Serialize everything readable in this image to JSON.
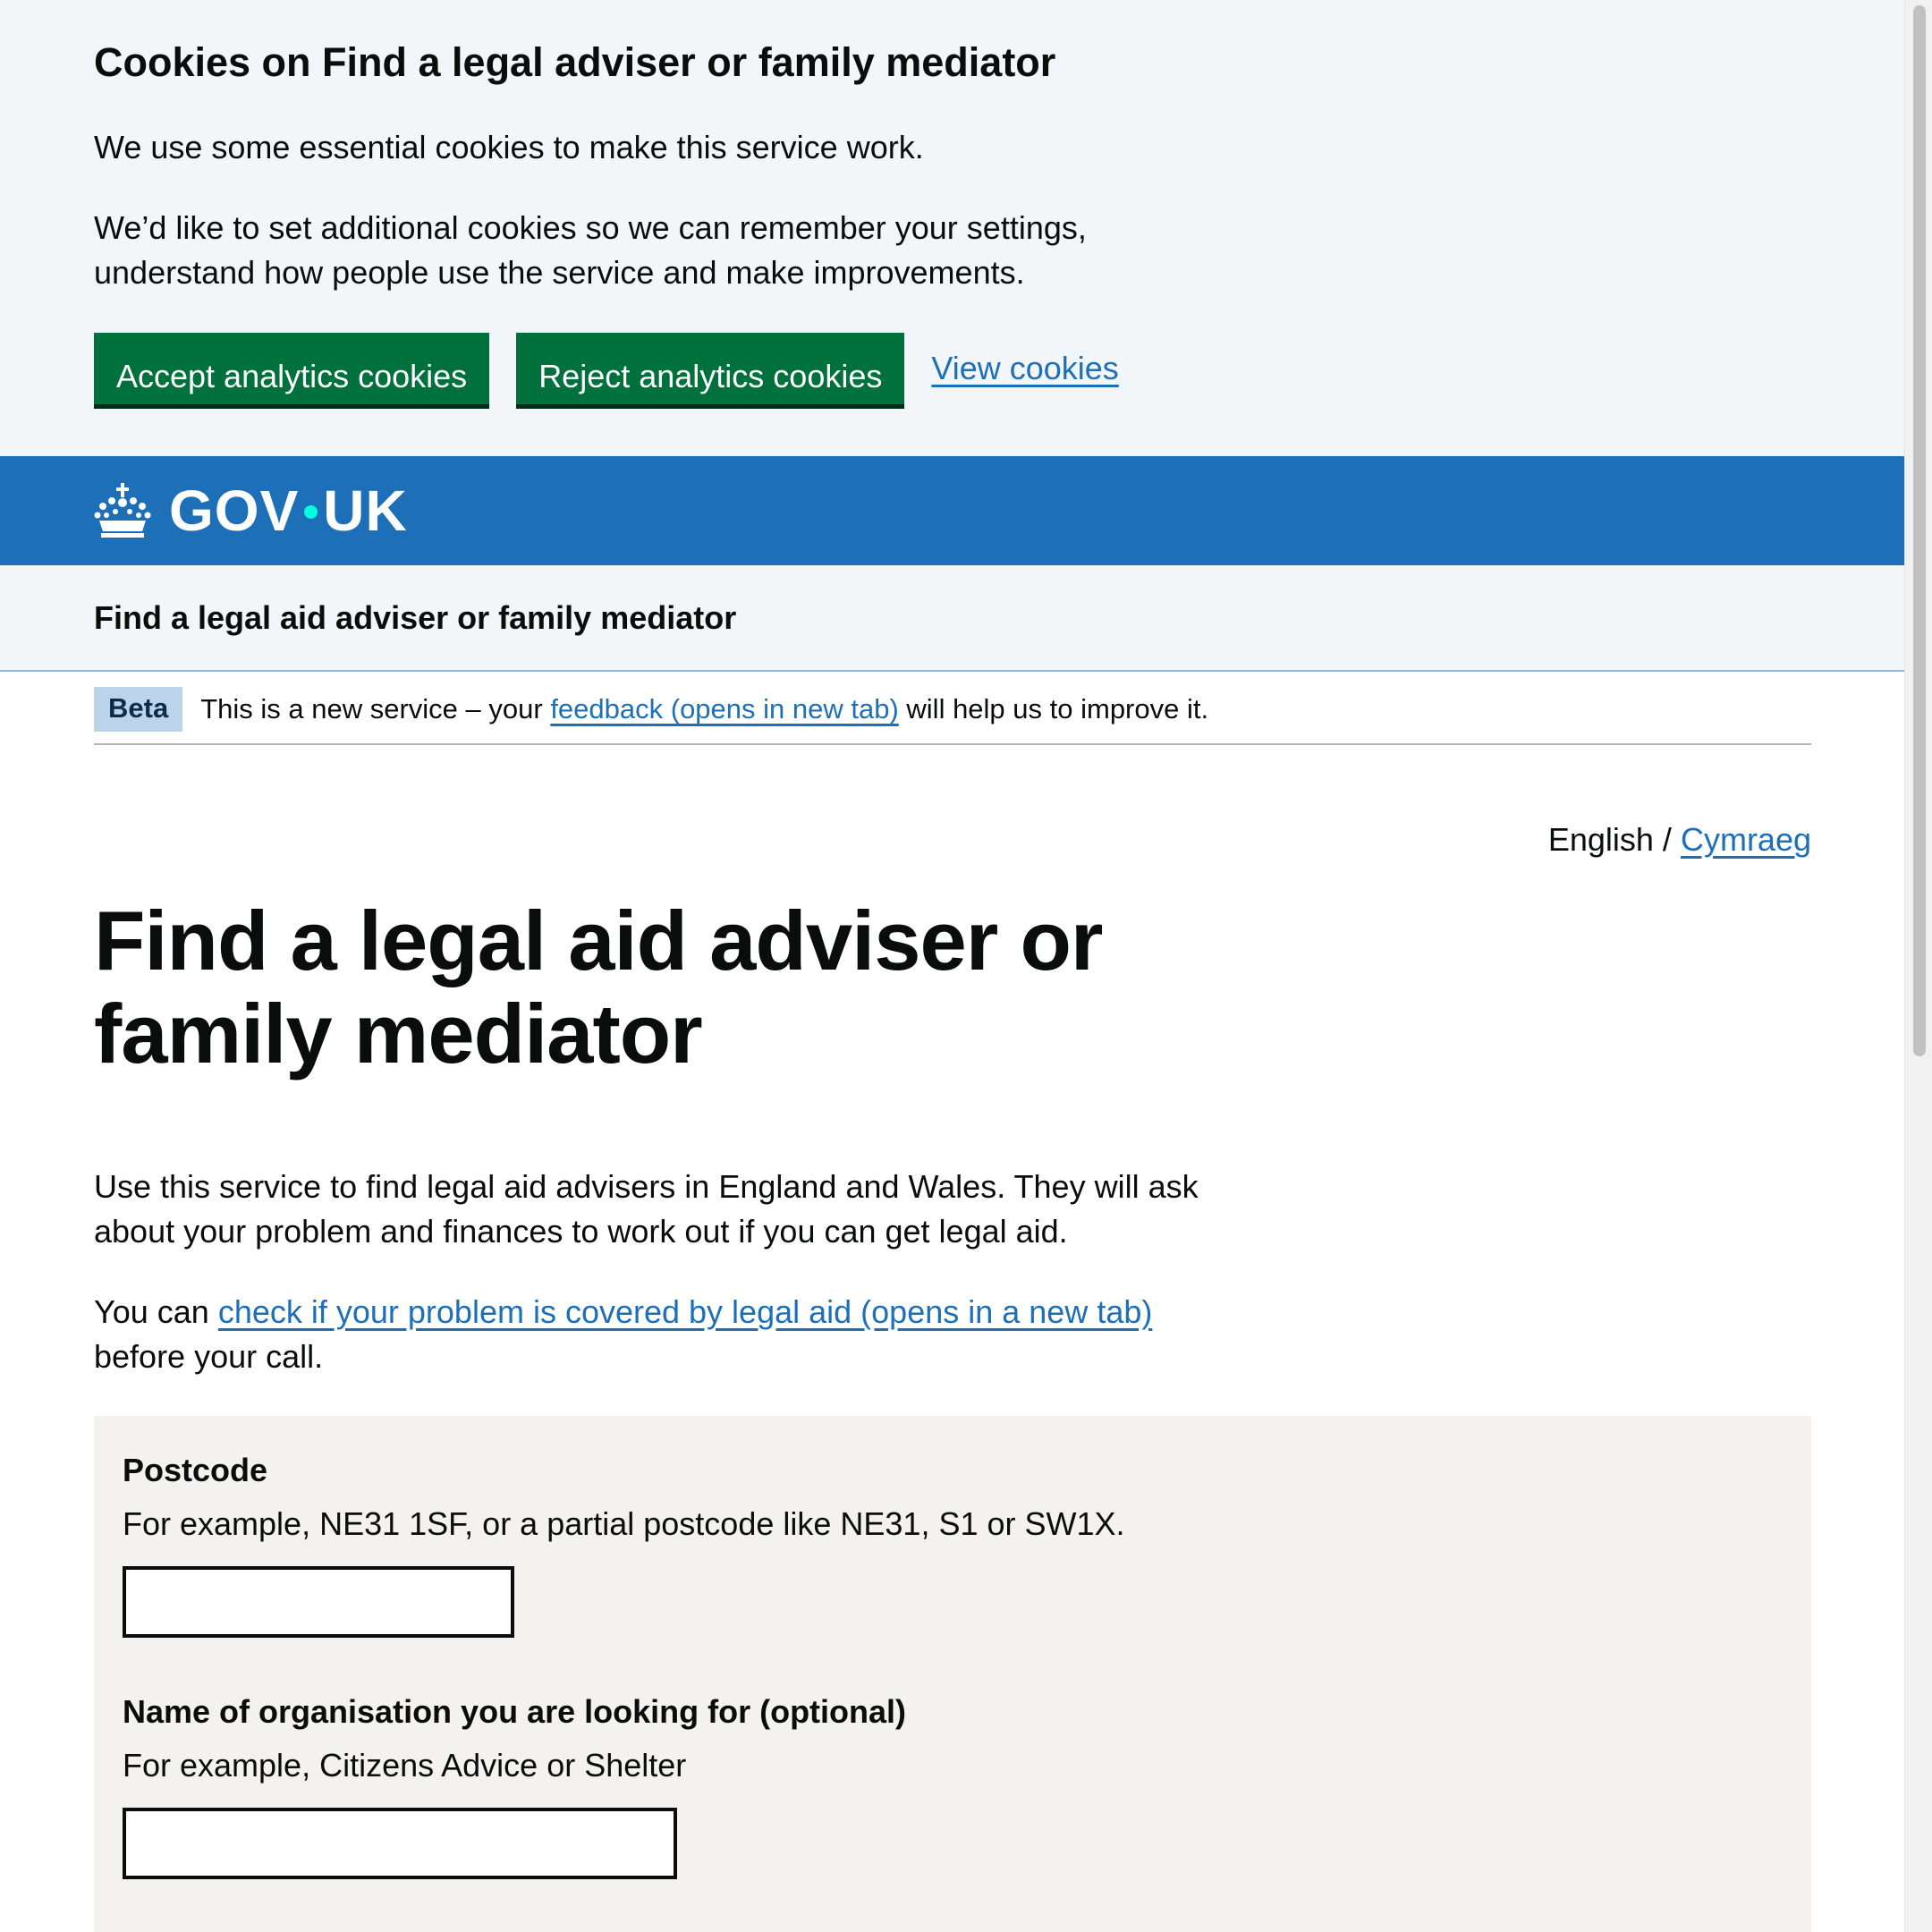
{
  "cookie_banner": {
    "title": "Cookies on Find a legal adviser or family mediator",
    "text_1": "We use some essential cookies to make this service work.",
    "text_2": "We’d like to set additional cookies so we can remember your settings, understand how people use the service and make improvements.",
    "accept_label": "Accept analytics cookies",
    "reject_label": "Reject analytics cookies",
    "view_label": "View cookies"
  },
  "header": {
    "logo_text_1": "GOV",
    "logo_text_2": "UK",
    "icon": "crown-icon"
  },
  "service": {
    "name": "Find a legal aid adviser or family mediator"
  },
  "phase_banner": {
    "tag": "Beta",
    "text_before": "This is a new service – your",
    "link_text": "feedback (opens in new tab)",
    "text_after": "will help us to improve it."
  },
  "language": {
    "current": "English",
    "separator": "/",
    "other": "Cymraeg"
  },
  "main": {
    "title": "Find a legal aid adviser or family mediator",
    "intro": "Use this service to find legal aid advisers in England and Wales. They will ask about your problem and finances to work out if you can get legal aid.",
    "intro2_before": "You can",
    "intro2_link": "check if your problem is covered by legal aid (opens in a new tab)",
    "intro2_after": "before your call."
  },
  "form": {
    "postcode_label": "Postcode",
    "postcode_hint": "For example, NE31 1SF, or a partial postcode like NE31, S1 or SW1X.",
    "postcode_value": "",
    "organisation_label": "Name of organisation you are looking for (optional)",
    "organisation_hint": "For example, Citizens Advice or Shelter",
    "organisation_value": ""
  },
  "colors": {
    "brand_blue": "#1d70b8",
    "button_green": "#00703c",
    "link": "#1d70b8",
    "banner_bg": "#f3f6f9",
    "panel_bg": "#f3f2f1",
    "beta_tag_bg": "#bbd4ea"
  }
}
